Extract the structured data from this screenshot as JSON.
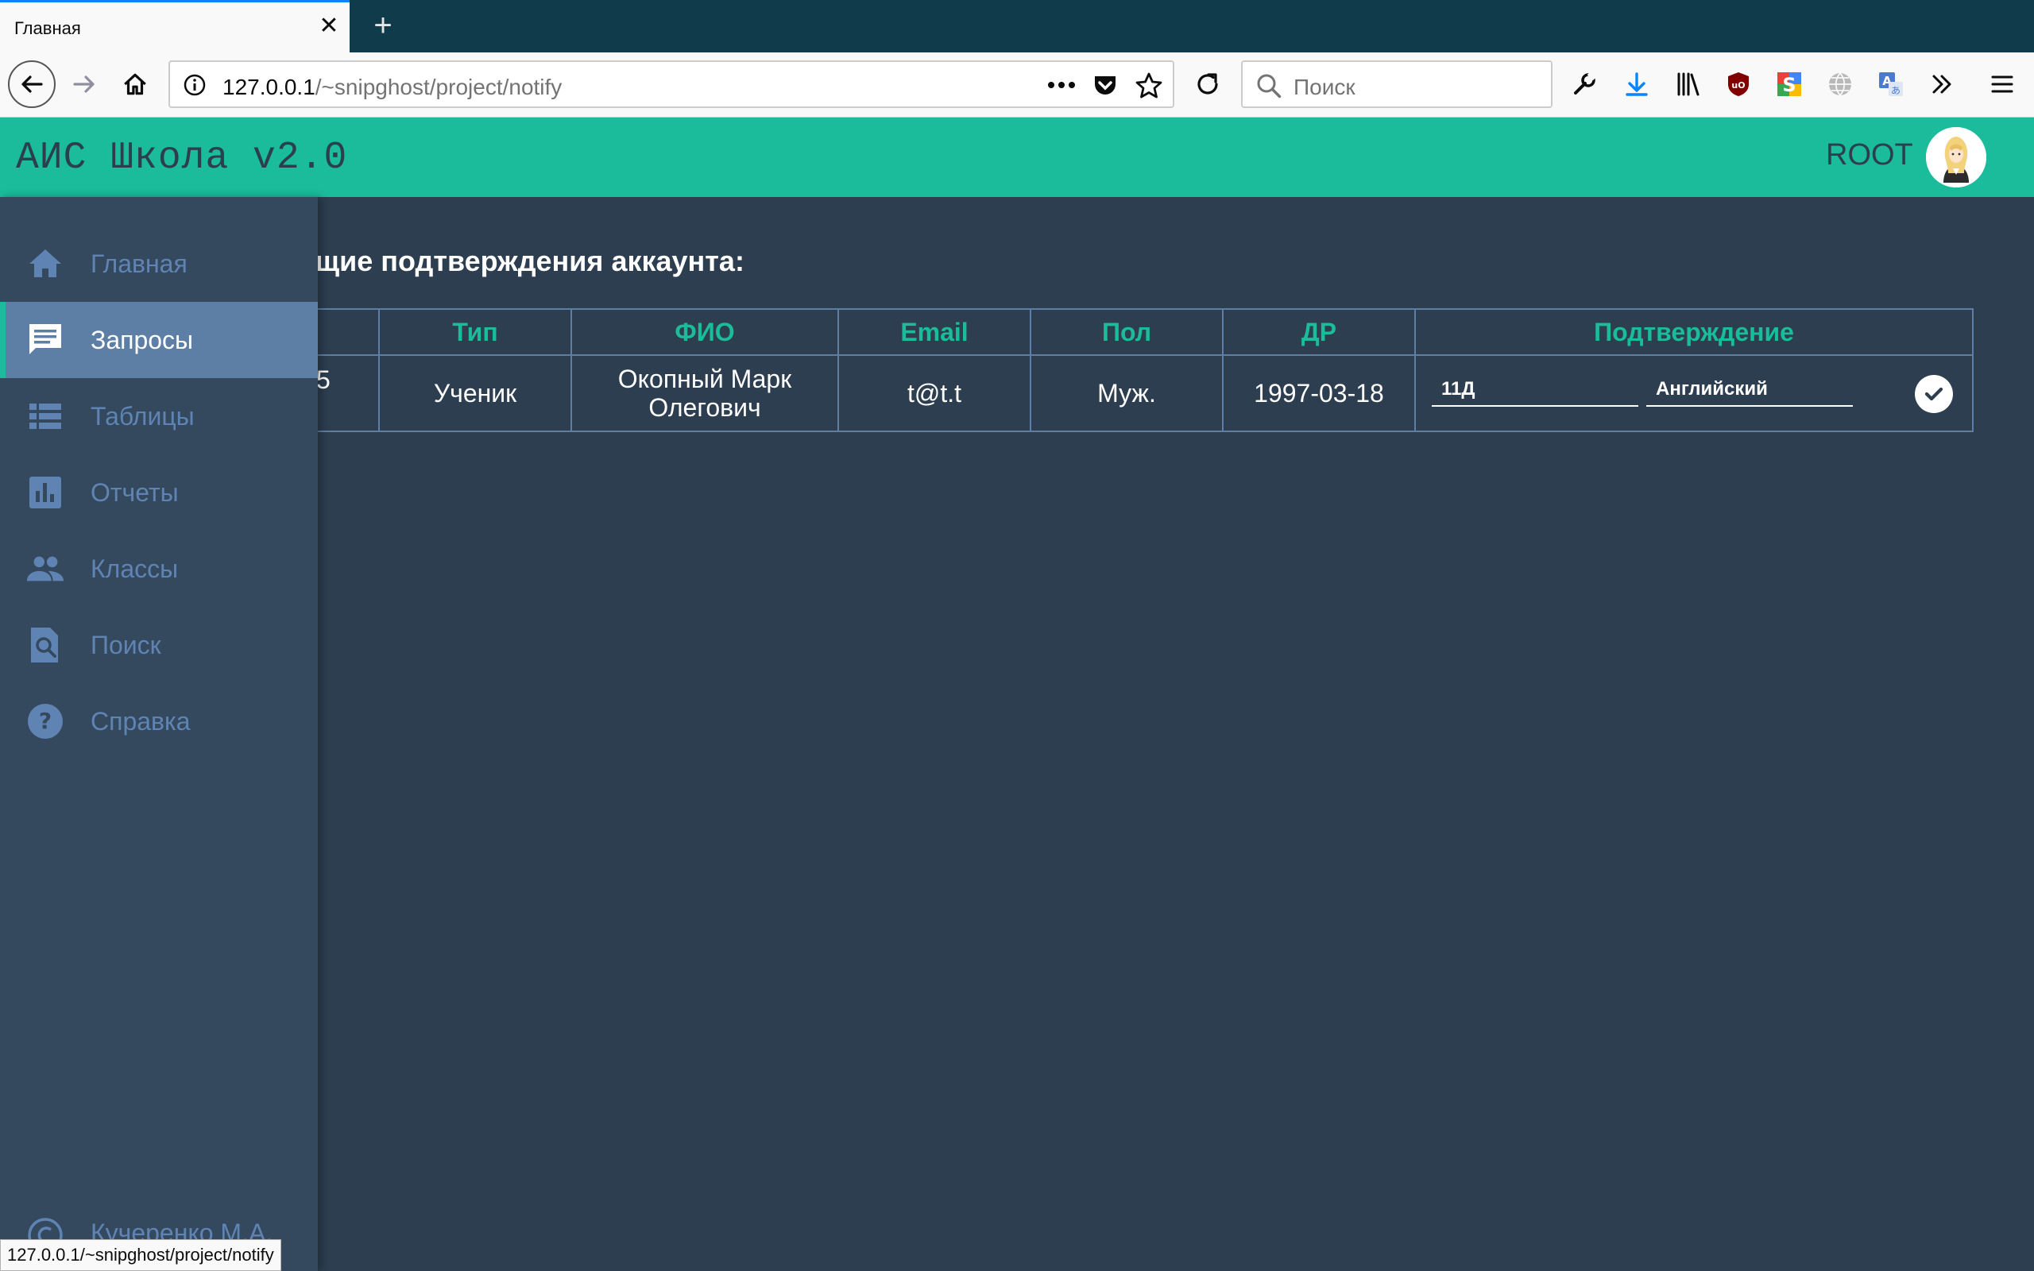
{
  "browser": {
    "tab_title": "Главная",
    "tab_close": "✕",
    "new_tab": "+",
    "url_host": "127.0.0.1",
    "url_path": "/~snipghost/project/notify",
    "search_placeholder": "Поиск",
    "status_url": "127.0.0.1/~snipghost/project/notify"
  },
  "header": {
    "title": "АИС Школа v2.0",
    "user": "ROOT"
  },
  "sidebar": {
    "items": [
      {
        "label": "Главная",
        "icon": "home-icon"
      },
      {
        "label": "Запросы",
        "icon": "message-icon"
      },
      {
        "label": "Таблицы",
        "icon": "table-icon"
      },
      {
        "label": "Отчеты",
        "icon": "bar-chart-icon"
      },
      {
        "label": "Классы",
        "icon": "people-icon"
      },
      {
        "label": "Поиск",
        "icon": "search-doc-icon"
      },
      {
        "label": "Справка",
        "icon": "help-icon"
      }
    ],
    "active_index": 1,
    "footer": "Кучеренко М.А."
  },
  "main": {
    "heading": "ли, требующие подтверждения аккаунта:",
    "table": {
      "headers": [
        "",
        "Тип",
        "ФИО",
        "Email",
        "Пол",
        "ДР",
        "Подтверждение"
      ],
      "row": {
        "id": "5",
        "type": "Ученик",
        "fio_line1": "Окопный Марк",
        "fio_line2": "Олегович",
        "email": "t@t.t",
        "gender": "Муж.",
        "birthdate": "1997-03-18",
        "class_value": "11Д",
        "language_value": "Английский"
      }
    }
  },
  "colors": {
    "accent": "#1abc9c",
    "background": "#2c3e50",
    "sidebar": "#34495e",
    "sidebar_text": "#5f84b4",
    "active_item": "#5d7fa6"
  }
}
